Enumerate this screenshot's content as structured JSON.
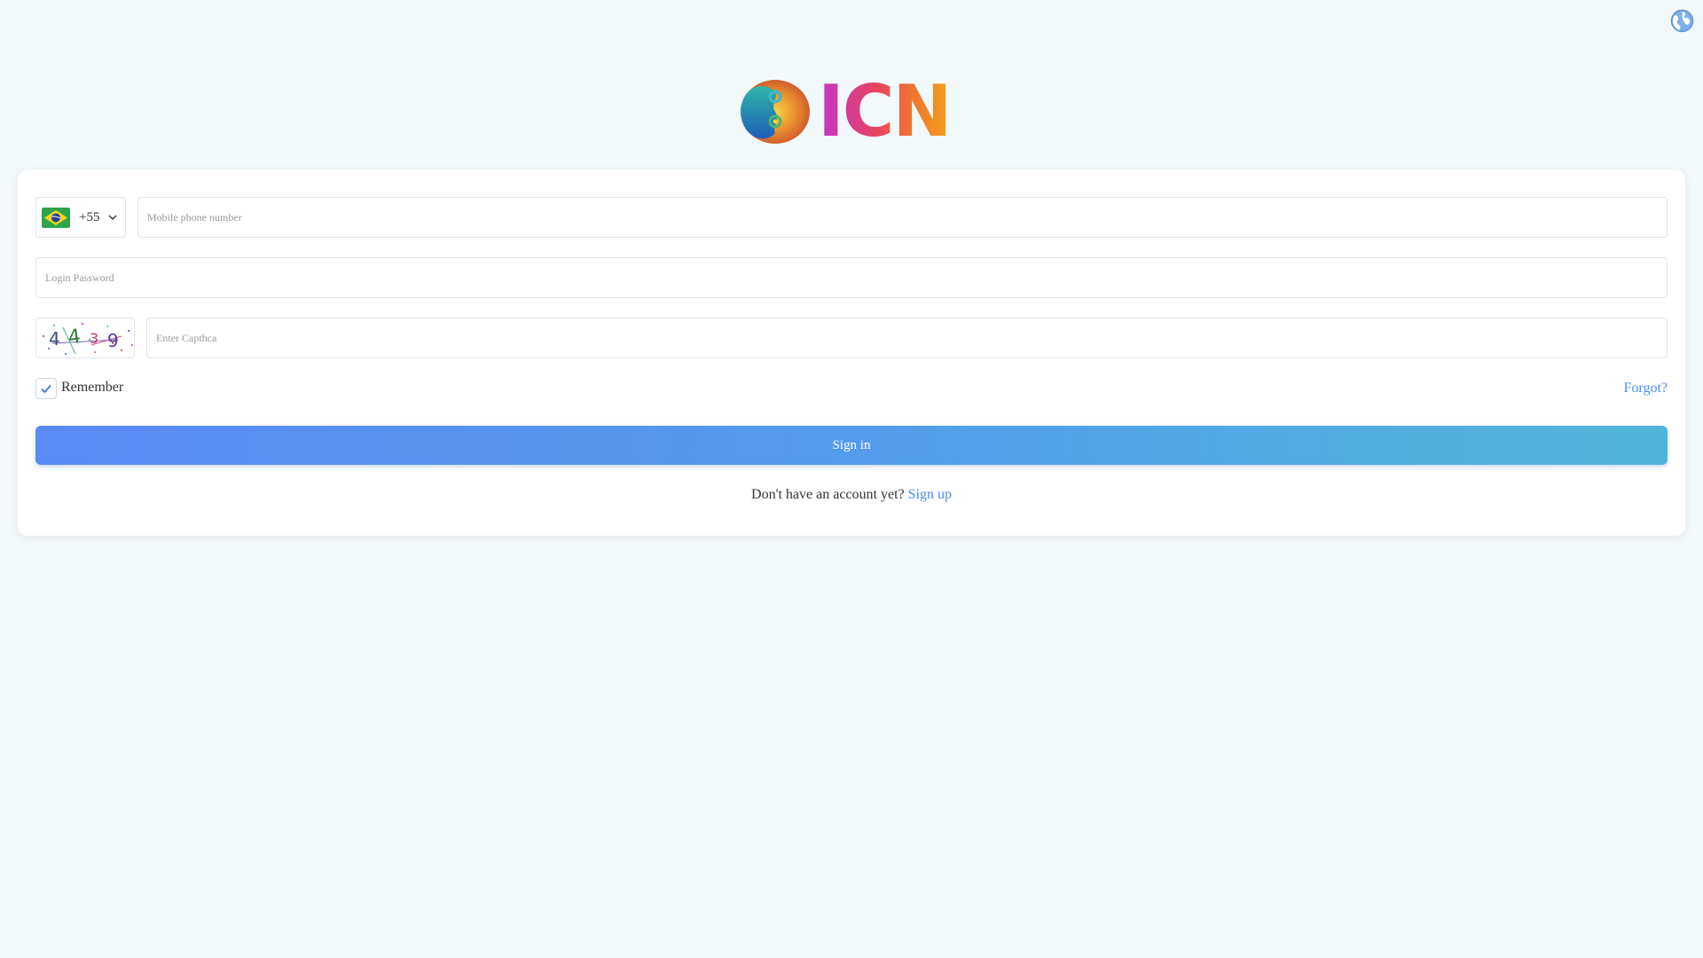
{
  "header": {
    "logo_text": "ICN",
    "language_icon": "globe-icon"
  },
  "form": {
    "country": {
      "flag_icon": "brazil-flag-icon",
      "code": "+55",
      "dropdown_icon": "chevron-down-icon"
    },
    "phone": {
      "placeholder": "Mobile phone number",
      "value": ""
    },
    "password": {
      "placeholder": "Login Password",
      "value": ""
    },
    "captcha": {
      "image_text": "4439",
      "placeholder": "Enter Capthca",
      "value": ""
    },
    "remember": {
      "label": "Remember",
      "checked": true
    },
    "forgot_label": "Forgot?",
    "signin_label": "Sign in",
    "signup_prompt": "Don't have an account yet?",
    "signup_label": "Sign up"
  },
  "colors": {
    "background": "#f3f8fb",
    "card": "#ffffff",
    "link": "#4a8df0",
    "button_gradient_start": "#5a8af5",
    "button_gradient_end": "#4fb5d8"
  }
}
